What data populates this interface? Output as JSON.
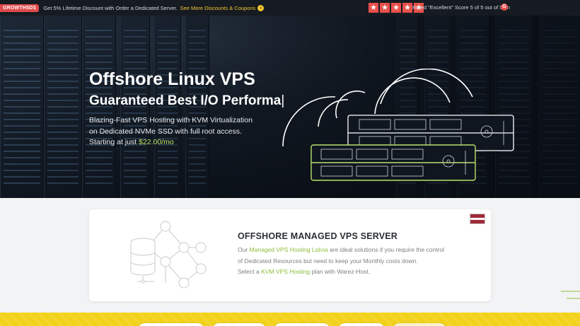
{
  "topbar": {
    "promo_code": "GROWTH5DS",
    "promo_text": "Get 5% Lifetime Discount with Order a Dedicated Server.",
    "promo_link": "See More Discounts & Coupons",
    "rating_text": "Rated \"Excellent\" Score 5 of 5 out of 5 on",
    "rating_icon": "g-review-icon",
    "stars": 5,
    "star_color": "#e8504a"
  },
  "hero": {
    "title": "Offshore Linux VPS",
    "subtitle": "Guaranteed Best I/O Performa",
    "cursor": "|",
    "desc_line1": "Blazing-Fast VPS Hosting with KVM Virtualization",
    "desc_line2": "on Dedicated NVMe SSD with full root access.",
    "price_prefix": "Starting at just",
    "price": "$22.00/mo",
    "accent": "#b8e26a",
    "illustration": "server-rack-illustration"
  },
  "card": {
    "title": "OFFSHORE MANAGED VPS SERVER",
    "p1_prefix": "Our",
    "p1_link": "Managed VPS Hosting Latvia",
    "p1_suffix": "are ideal solutions if you require the control",
    "p2": "of Dedicated Resources but need to keep your Monthly costs down.",
    "p3_prefix": "Select a",
    "p3_link": "KVM VPS Hosting",
    "p3_suffix": "plan with Warez-Host.",
    "flag": "latvia-flag-icon",
    "illustration": "database-network-icon",
    "link_color": "#8cbf3b"
  },
  "band": {
    "color": "#f2d21a"
  }
}
